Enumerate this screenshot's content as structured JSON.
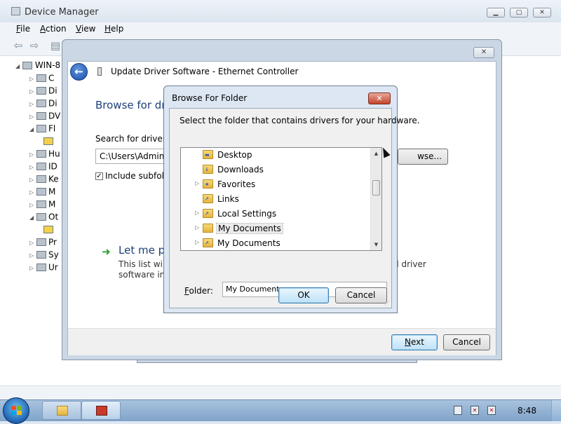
{
  "device_manager": {
    "title": "Device Manager",
    "menu": [
      {
        "label": "File",
        "accel": "F",
        "rest": "ile"
      },
      {
        "label": "Action",
        "accel": "A",
        "rest": "ction"
      },
      {
        "label": "View",
        "accel": "V",
        "rest": "iew"
      },
      {
        "label": "Help",
        "accel": "H",
        "rest": "elp"
      }
    ],
    "tree_root": "WIN-8",
    "tree_items": [
      "C",
      "Di",
      "Di",
      "DV",
      "Fl",
      "",
      "Hu",
      "ID",
      "Ke",
      "M",
      "M",
      "Ot",
      "",
      "Pr",
      "Sy",
      "Ur"
    ]
  },
  "wizard": {
    "header_title": "Update Driver Software - Ethernet Controller",
    "heading": "Browse for dri",
    "search_label": "Search for driver so",
    "path_value": "C:\\Users\\Adminis",
    "browse_label": "wse...",
    "include_subfolders_label": "Include subfold",
    "include_subfolders_checked": true,
    "let_me_pick_title": "Let me pi",
    "desc_line1": "This list will s",
    "desc_line1_end": "ll driver",
    "desc_line2": "software in t",
    "next_label": "Next",
    "next_accel": "N",
    "next_rest": "ext",
    "cancel_label": "Cancel"
  },
  "browse_folder": {
    "title": "Browse For Folder",
    "close_glyph": "✕",
    "prompt": "Select the folder that contains drivers for your hardware.",
    "folders": [
      {
        "label": "Desktop",
        "expandable": false,
        "overlay": "▬",
        "selected": false
      },
      {
        "label": "Downloads",
        "expandable": false,
        "overlay": "↓",
        "selected": false
      },
      {
        "label": "Favorites",
        "expandable": true,
        "overlay": "★",
        "selected": false
      },
      {
        "label": "Links",
        "expandable": false,
        "overlay": "↗",
        "selected": false
      },
      {
        "label": "Local Settings",
        "expandable": true,
        "overlay": "↗",
        "selected": false
      },
      {
        "label": "My Documents",
        "expandable": true,
        "overlay": "",
        "selected": true
      },
      {
        "label": "My Documents",
        "expandable": true,
        "overlay": "↗",
        "selected": false
      }
    ],
    "folder_label": "Folder:",
    "folder_label_accel": "F",
    "folder_label_rest": "older:",
    "folder_value": "My Documents",
    "ok_label": "OK",
    "cancel_label": "Cancel"
  },
  "taskbar": {
    "clock": "8:48"
  },
  "colors": {
    "accent_blue": "#1e3f7a",
    "close_red": "#c5432a",
    "green_arrow": "#1f9a2a"
  }
}
